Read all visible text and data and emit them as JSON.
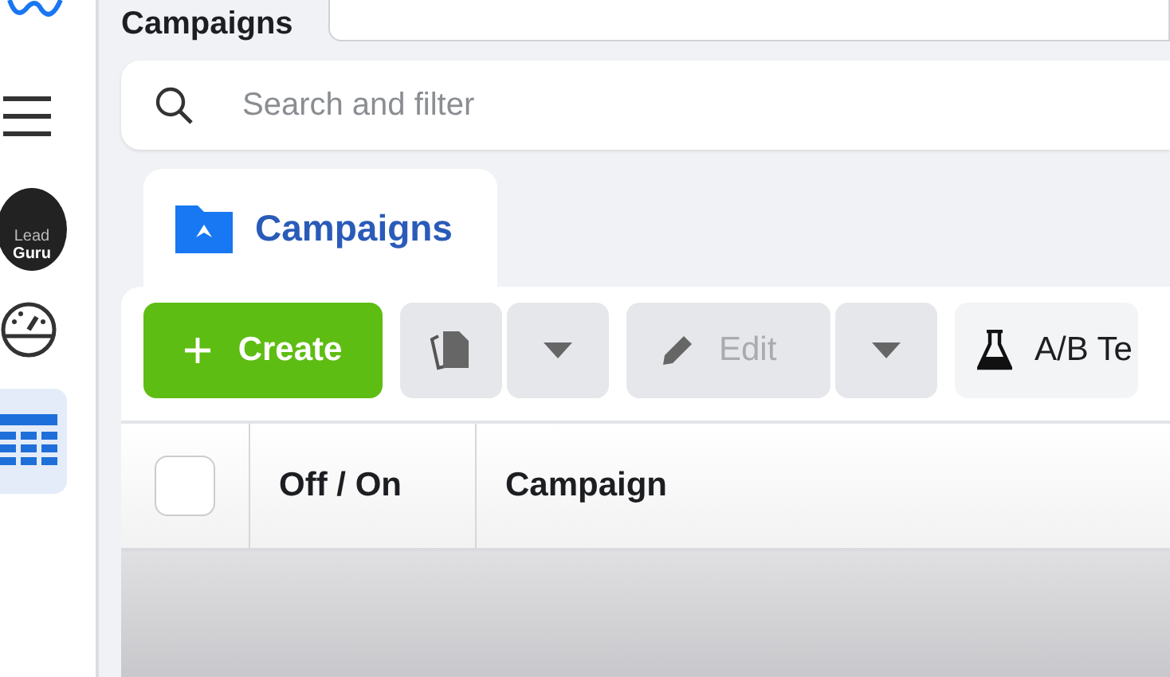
{
  "page_title": "Campaigns",
  "sidebar": {
    "account": {
      "line1": "Lead",
      "line2": "Guru"
    },
    "nav_items": [
      {
        "kind": "gauge",
        "selected": false
      },
      {
        "kind": "table",
        "selected": true
      }
    ]
  },
  "search": {
    "placeholder": "Search and filter"
  },
  "tab": {
    "label": "Campaigns",
    "selected": true
  },
  "toolbar": [
    {
      "kind": "create",
      "label": "Create",
      "disabled": false
    },
    {
      "kind": "duplicate",
      "disabled": true
    },
    {
      "kind": "dropdown",
      "disabled": true
    },
    {
      "kind": "edit",
      "label": "Edit",
      "disabled": true
    },
    {
      "kind": "dropdown",
      "disabled": true
    },
    {
      "kind": "abtest",
      "label": "A/B Te",
      "disabled": false
    }
  ],
  "table": {
    "select_all": {
      "checked": false
    },
    "columns": [
      "Off / On",
      "Campaign"
    ]
  }
}
